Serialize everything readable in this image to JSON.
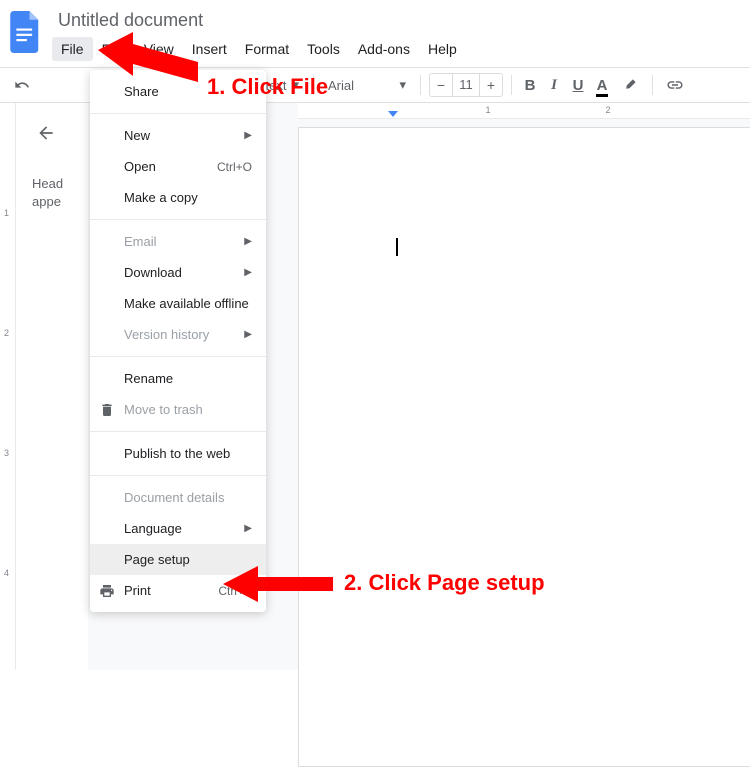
{
  "doc_title": "Untitled document",
  "menubar": [
    "File",
    "Edit",
    "View",
    "Insert",
    "Format",
    "Tools",
    "Add-ons",
    "Help"
  ],
  "toolbar": {
    "text_style": "Normal text",
    "font": "Arial",
    "font_size": "11"
  },
  "outline": {
    "hint": "Head\nappe"
  },
  "file_menu": {
    "share": "Share",
    "new": "New",
    "open": "Open",
    "open_sc": "Ctrl+O",
    "copy": "Make a copy",
    "email": "Email",
    "download": "Download",
    "offline": "Make available offline",
    "version": "Version history",
    "rename": "Rename",
    "trash": "Move to trash",
    "publish": "Publish to the web",
    "details": "Document details",
    "language": "Language",
    "page_setup": "Page setup",
    "print": "Print",
    "print_sc": "Ctrl+P"
  },
  "annotations": {
    "a1": "1. Click File",
    "a2": "2. Click Page setup"
  },
  "ruler": {
    "h": [
      "1",
      "2"
    ],
    "v": [
      "1",
      "2",
      "3",
      "4"
    ]
  }
}
